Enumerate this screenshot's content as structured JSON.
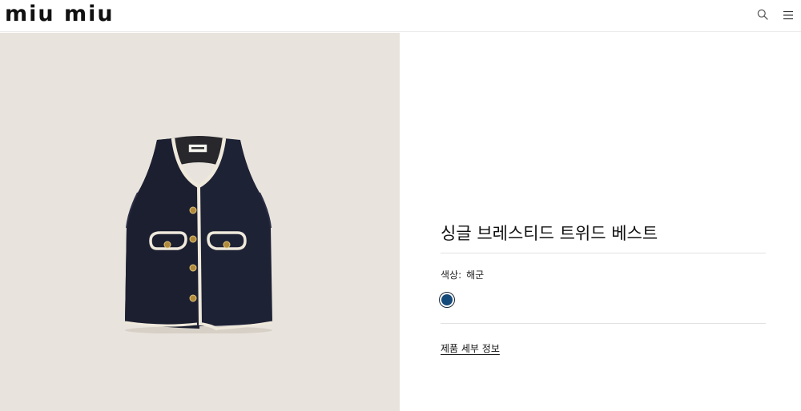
{
  "header": {
    "brand": "miu miu",
    "icons": [
      "search-icon",
      "hamburger-menu-icon"
    ]
  },
  "product": {
    "image_background": "#e8e3dc",
    "title": "싱글 브레스티드 트위드 베스트",
    "color_label": "색상:",
    "color_value": "해군",
    "swatch_color": "#154b7a",
    "details_link": "제품 세부 정보"
  }
}
